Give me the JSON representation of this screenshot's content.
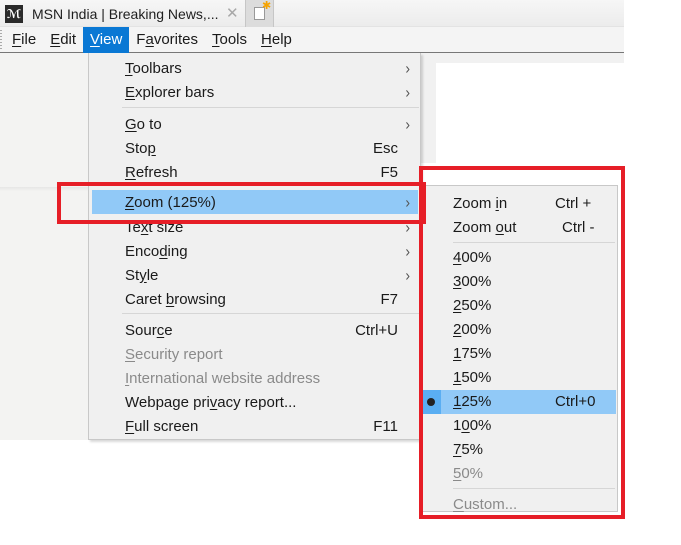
{
  "browser": {
    "tab": {
      "title": "MSN India | Breaking News,...",
      "favicon": "msn-logo-icon",
      "close_glyph": "✕"
    },
    "new_tab_button": "new-tab-icon"
  },
  "menubar": {
    "items": [
      {
        "label": "File",
        "mnemonic": "F",
        "rest": "ile",
        "active": false
      },
      {
        "label": "Edit",
        "mnemonic": "E",
        "rest": "dit",
        "active": false
      },
      {
        "label": "View",
        "mnemonic": "V",
        "rest": "iew",
        "active": true
      },
      {
        "label": "Favorites",
        "pre": "F",
        "mnemonic": "a",
        "rest": "vorites",
        "active": false
      },
      {
        "label": "Tools",
        "mnemonic": "T",
        "rest": "ools",
        "active": false
      },
      {
        "label": "Help",
        "mnemonic": "H",
        "rest": "elp",
        "active": false
      }
    ]
  },
  "view_menu": {
    "items": [
      {
        "label": "Toolbars",
        "pre": "",
        "u": "T",
        "post": "oolbars",
        "shortcut": "",
        "submenu": true,
        "disabled": false
      },
      {
        "label": "Explorer bars",
        "pre": "",
        "u": "E",
        "post": "xplorer bars",
        "shortcut": "",
        "submenu": true,
        "disabled": false
      },
      {
        "label": "Go to",
        "pre": "",
        "u": "G",
        "post": "o to",
        "shortcut": "",
        "submenu": true,
        "disabled": false
      },
      {
        "label": "Stop",
        "pre": "Sto",
        "u": "p",
        "post": "",
        "shortcut": "Esc",
        "submenu": false,
        "disabled": false
      },
      {
        "label": "Refresh",
        "pre": "",
        "u": "R",
        "post": "efresh",
        "shortcut": "F5",
        "submenu": false,
        "disabled": false
      },
      {
        "label": "Zoom (125%)",
        "pre": "",
        "u": "Z",
        "post": "oom (125%)",
        "shortcut": "",
        "submenu": true,
        "disabled": false,
        "highlighted": true
      },
      {
        "label": "Text size",
        "pre": "Te",
        "u": "x",
        "post": "t size",
        "shortcut": "",
        "submenu": true,
        "disabled": false
      },
      {
        "label": "Encoding",
        "pre": "Enco",
        "u": "d",
        "post": "ing",
        "shortcut": "",
        "submenu": true,
        "disabled": false
      },
      {
        "label": "Style",
        "pre": "St",
        "u": "y",
        "post": "le",
        "shortcut": "",
        "submenu": true,
        "disabled": false
      },
      {
        "label": "Caret browsing",
        "pre": "Caret ",
        "u": "b",
        "post": "rowsing",
        "shortcut": "F7",
        "submenu": false,
        "disabled": false
      },
      {
        "label": "Source",
        "pre": "Sour",
        "u": "c",
        "post": "e",
        "shortcut": "Ctrl+U",
        "submenu": false,
        "disabled": false
      },
      {
        "label": "Security report",
        "pre": "",
        "u": "S",
        "post": "ecurity report",
        "shortcut": "",
        "submenu": false,
        "disabled": true
      },
      {
        "label": "International website address",
        "pre": "",
        "u": "I",
        "post": "nternational website address",
        "shortcut": "",
        "submenu": false,
        "disabled": true
      },
      {
        "label": "Webpage privacy report...",
        "pre": "Webpage pri",
        "u": "v",
        "post": "acy report...",
        "shortcut": "",
        "submenu": false,
        "disabled": false
      },
      {
        "label": "Full screen",
        "pre": "",
        "u": "F",
        "post": "ull screen",
        "shortcut": "F11",
        "submenu": false,
        "disabled": false
      }
    ],
    "arrow_glyph": "›"
  },
  "zoom_submenu": {
    "items": [
      {
        "label": "Zoom in",
        "pre": "Zoom ",
        "u": "i",
        "post": "n",
        "shortcut": "Ctrl +",
        "disabled": false,
        "checked": false
      },
      {
        "label": "Zoom out",
        "pre": "Zoom ",
        "u": "o",
        "post": "ut",
        "shortcut": "Ctrl -",
        "disabled": false,
        "checked": false
      },
      {
        "label": "400%",
        "pre": "",
        "u": "4",
        "post": "00%",
        "shortcut": "",
        "disabled": false,
        "checked": false
      },
      {
        "label": "300%",
        "pre": "",
        "u": "3",
        "post": "00%",
        "shortcut": "",
        "disabled": false,
        "checked": false
      },
      {
        "label": "250%",
        "pre": "",
        "u": "2",
        "post": "50%",
        "shortcut": "",
        "disabled": false,
        "checked": false
      },
      {
        "label": "200%",
        "pre": "",
        "u": "2",
        "post": "00%",
        "shortcut": "",
        "disabled": false,
        "checked": false
      },
      {
        "label": "175%",
        "pre": "",
        "u": "1",
        "post": "75%",
        "shortcut": "",
        "disabled": false,
        "checked": false
      },
      {
        "label": "150%",
        "pre": "",
        "u": "1",
        "post": "50%",
        "shortcut": "",
        "disabled": false,
        "checked": false
      },
      {
        "label": "125%",
        "pre": "",
        "u": "1",
        "post": "25%",
        "shortcut": "Ctrl+0",
        "disabled": false,
        "checked": true
      },
      {
        "label": "100%",
        "pre": "1",
        "u": "0",
        "post": "0%",
        "shortcut": "",
        "disabled": false,
        "checked": false
      },
      {
        "label": "75%",
        "pre": "",
        "u": "7",
        "post": "5%",
        "shortcut": "",
        "disabled": false,
        "checked": false
      },
      {
        "label": "50%",
        "pre": "",
        "u": "5",
        "post": "0%",
        "shortcut": "",
        "disabled": true,
        "checked": false
      },
      {
        "label": "Custom...",
        "pre": "",
        "u": "C",
        "post": "ustom...",
        "shortcut": "",
        "disabled": true,
        "checked": false
      }
    ]
  },
  "annotations": {
    "color": "#e61e27",
    "boxes": [
      "zoom-menu-item-highlight",
      "zoom-submenu-highlight"
    ]
  }
}
